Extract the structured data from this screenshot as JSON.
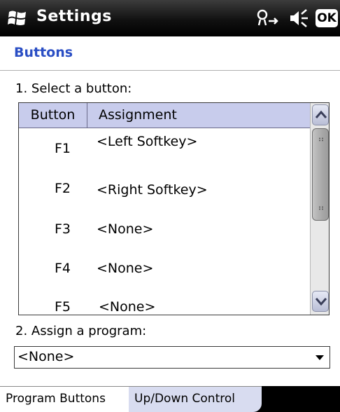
{
  "titlebar": {
    "title": "Settings",
    "ok_label": "OK"
  },
  "page_title": "Buttons",
  "step1_label": "1. Select a button:",
  "list": {
    "headers": {
      "button": "Button",
      "assignment": "Assignment"
    },
    "rows": [
      {
        "button": "F1",
        "assignment": "<Left Softkey>"
      },
      {
        "button": "F2",
        "assignment": "<Right Softkey>"
      },
      {
        "button": "F3",
        "assignment": "<None>"
      },
      {
        "button": "F4",
        "assignment": "<None>"
      },
      {
        "button": "F5",
        "assignment": "<None>"
      }
    ]
  },
  "step2_label": "2. Assign a program:",
  "program_select": {
    "value": "<None>"
  },
  "tabs": [
    {
      "label": "Program Buttons"
    },
    {
      "label": "Up/Down Control"
    }
  ],
  "colors": {
    "accent": "#2a4ec4",
    "header_bg": "#c8ccec"
  }
}
